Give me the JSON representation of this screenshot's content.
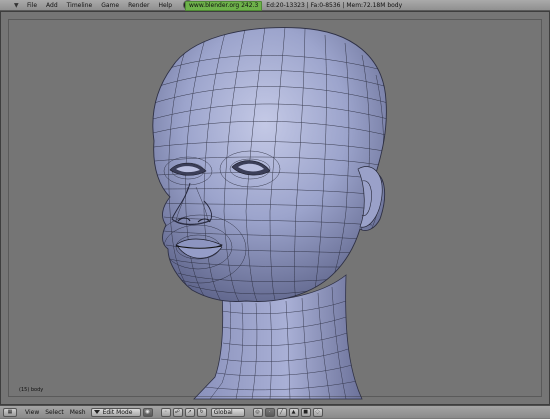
{
  "topbar": {
    "menus": [
      "File",
      "Add",
      "Timeline",
      "Game",
      "Render",
      "Help"
    ],
    "url": "www.blender.org 242.3",
    "stats": "Ed:20-13323 | Fa:0-8536 | Mem:72.18M body"
  },
  "viewport": {
    "object_label": "(15) body",
    "background_color": "#757575",
    "mesh_color": "#9ca4cc"
  },
  "bottombar": {
    "menus": [
      "View",
      "Select",
      "Mesh"
    ],
    "mode": "Edit Mode",
    "orientation": "Global"
  }
}
